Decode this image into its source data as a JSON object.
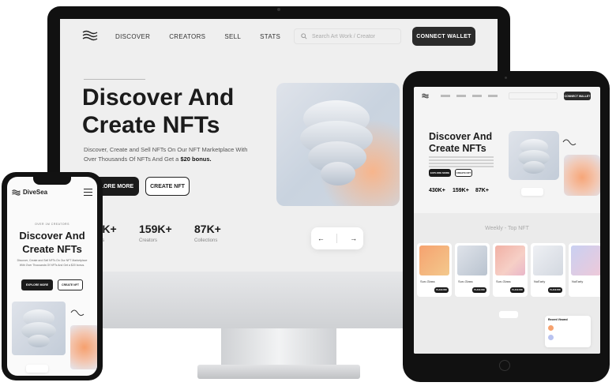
{
  "desktop": {
    "nav": [
      "DISCOVER",
      "CREATORS",
      "SELL",
      "STATS"
    ],
    "search_placeholder": "Search Art Work / Creator",
    "connect_label": "CONNECT WALLET",
    "hero_title": "Discover And Create NFTs",
    "hero_desc_lead": "Discover, Create and Sell NFTs On Our NFT Marketplace With Over Thousands Of NFTs And Get a",
    "hero_desc_bonus": "$20 bonus.",
    "explore_label": "EXPLORE MORE",
    "create_label": "CREATE NFT",
    "stats": [
      {
        "value": "430K+",
        "label": "Art Works"
      },
      {
        "value": "159K+",
        "label": "Creators"
      },
      {
        "value": "87K+",
        "label": "Collections"
      }
    ],
    "pager_prev": "←",
    "pager_next": "→"
  },
  "tablet": {
    "connect_label": "CONNECT WALLET",
    "hero_title": "Discover And Create NFTs",
    "explore_label": "EXPLORE MORE",
    "create_label": "CREATE NFT",
    "stats": [
      "430K+",
      "159K+",
      "87K+"
    ],
    "section_title": "Weekly - Top NFT",
    "cards": [
      "Sun-Glass",
      "Sun-Glass",
      "Sun-Glass",
      "NuEarly",
      "NuEarly"
    ],
    "recent_title": "Recent Viewed",
    "place_bid": "PLACE BID"
  },
  "phone": {
    "brand": "DiveSea",
    "eyebrow": "OVER 1M CREATORS",
    "hero_title": "Discover And Create NFTs",
    "hero_desc": "Discover, Create and Sell NFTs On Our NFT Marketplace With Over Thousands Of NFTs And Get a $20 bonus.",
    "explore_label": "EXPLORE MORE",
    "create_label": "CREATE NFT"
  },
  "device_icons": {
    "logo": "wave-logo-icon",
    "search": "search-icon",
    "menu": "hamburger-menu-icon",
    "apple": "apple-logo-icon"
  }
}
